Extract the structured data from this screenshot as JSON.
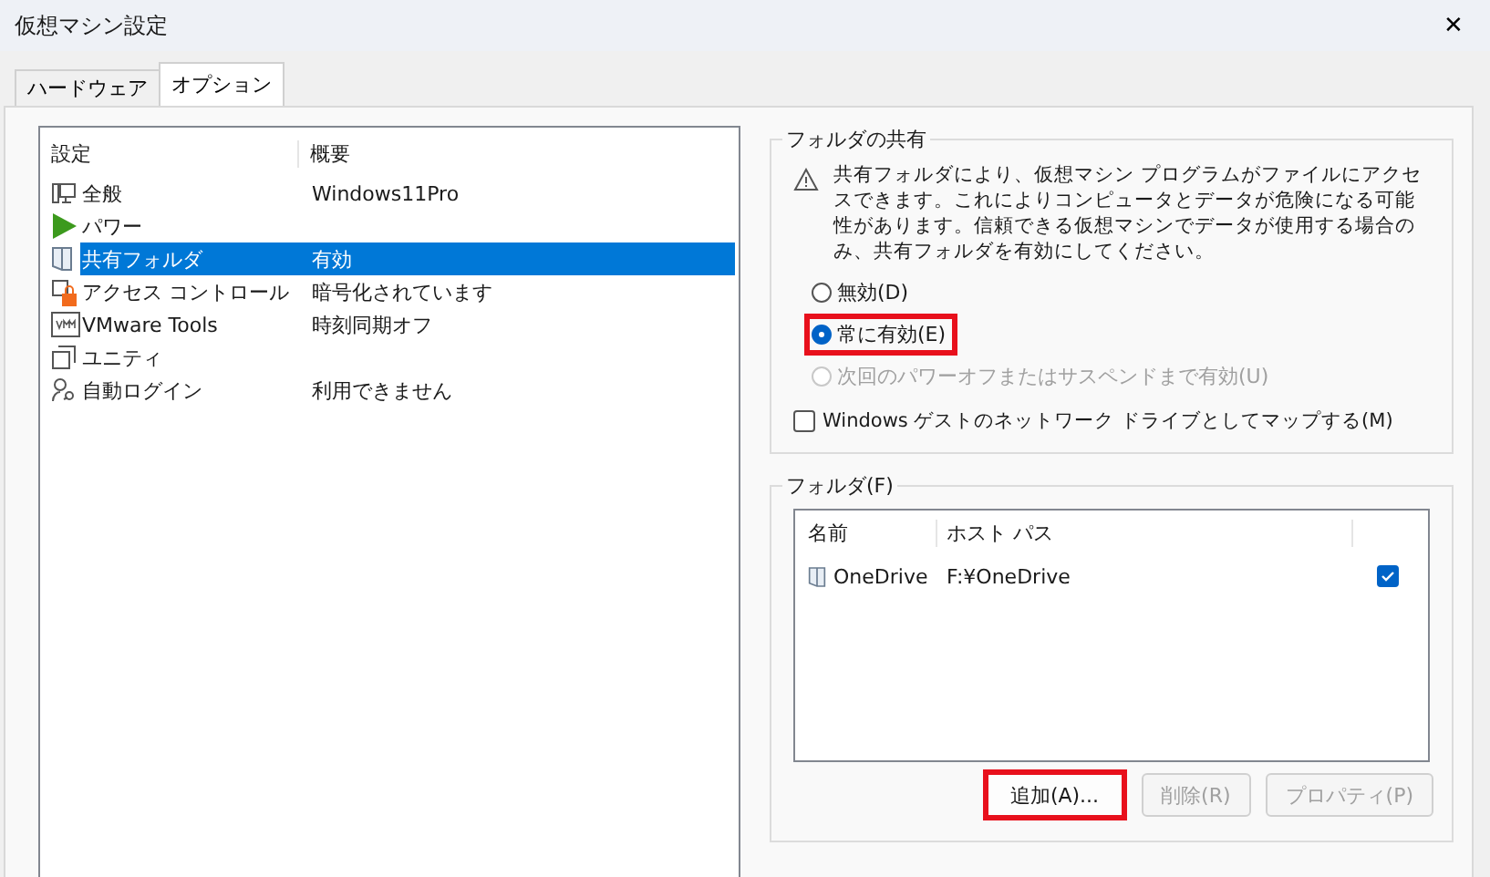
{
  "window": {
    "title": "仮想マシン設定",
    "close": "✕"
  },
  "tabs": [
    {
      "label": "ハードウェア",
      "selected": false
    },
    {
      "label": "オプション",
      "selected": true
    }
  ],
  "settings_list": {
    "columns": [
      "設定",
      "概要"
    ],
    "rows": [
      {
        "name": "全般",
        "summary": "Windows11Pro",
        "selected": false
      },
      {
        "name": "パワー",
        "selected": false
      },
      {
        "name": "共有フォルダ",
        "summary": "有効",
        "selected": true
      },
      {
        "name": "アクセス コントロール",
        "summary": "暗号化されています",
        "selected": false
      },
      {
        "name": "VMware Tools",
        "summary": "時刻同期オフ",
        "selected": false
      },
      {
        "name": "ユニティ",
        "selected": false
      },
      {
        "name": "自動ログイン",
        "summary": "利用できません",
        "selected": false
      }
    ]
  },
  "folder_sharing": {
    "title": "フォルダの共有",
    "warning": "共有フォルダにより、仮想マシン プログラムがファイルにアクセスできます。これによりコンピュータとデータが危険になる可能性があります。信頼できる仮想マシンでデータが使用する場合のみ、共有フォルダを有効にしてください。",
    "options": [
      {
        "label": "無効(D)",
        "selected": false,
        "disabled": false,
        "highlighted": false
      },
      {
        "label": "常に有効(E)",
        "selected": true,
        "disabled": false,
        "highlighted": true
      },
      {
        "label": "次回のパワーオフまたはサスペンドまで有効(U)",
        "selected": false,
        "disabled": true,
        "highlighted": false
      }
    ],
    "map_drive": {
      "label": "Windows ゲストのネットワーク ドライブとしてマップする(M)",
      "checked": false
    }
  },
  "folders": {
    "title": "フォルダ(F)",
    "columns": [
      "名前",
      "ホスト パス"
    ],
    "rows": [
      {
        "name": "OneDrive",
        "path": "F:¥OneDrive",
        "checked": true
      }
    ],
    "buttons": [
      {
        "label": "追加(A)...",
        "disabled": false,
        "highlighted": true
      },
      {
        "label": "削除(R)",
        "disabled": true,
        "highlighted": false
      },
      {
        "label": "プロパティ(P)",
        "disabled": true,
        "highlighted": false
      }
    ]
  }
}
